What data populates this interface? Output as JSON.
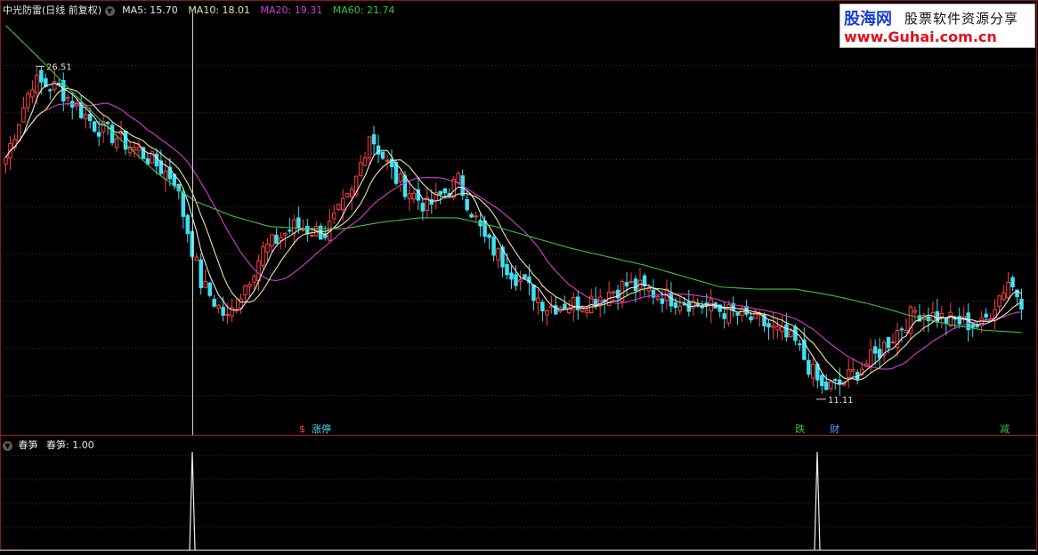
{
  "header": {
    "title": "中光防雷(日线 前复权)",
    "ma": [
      {
        "label": "MA5: 15.70",
        "color": "#e8e8e8"
      },
      {
        "label": "MA10: 18.01",
        "color": "#e8e8a0"
      },
      {
        "label": "MA20: 19.31",
        "color": "#d040d0"
      },
      {
        "label": "MA60: 21.74",
        "color": "#40c040"
      }
    ]
  },
  "indicator": {
    "name": "春笋",
    "value_label": "春笋: 1.00"
  },
  "watermark": {
    "line1_brand": "股海网",
    "line1_text": "股票软件资源分享",
    "line2": "www.Guhai.com.cn"
  },
  "chart_data": [
    {
      "type": "candlestick",
      "title": "中光防雷(日线 前复权)",
      "ylim": [
        9.5,
        29.0
      ],
      "grid": true,
      "colors": {
        "up": "#ff4040",
        "down": "#40e0f0",
        "ma5": "#e8e8e8",
        "ma10": "#e8e8a0",
        "ma20": "#d040d0",
        "ma60": "#40c040"
      },
      "annotations": [
        {
          "text": "26.51",
          "kind": "high",
          "value": 26.51
        },
        {
          "text": "11.11",
          "kind": "low",
          "value": 11.11
        }
      ],
      "signal_markers": [
        {
          "text": "$",
          "color": "#ff4040"
        },
        {
          "text": "涨停",
          "color": "#40e0f0"
        },
        {
          "text": "跌",
          "color": "#40c040"
        },
        {
          "text": "财",
          "color": "#40a0ff"
        },
        {
          "text": "减",
          "color": "#40c040"
        }
      ],
      "ma60_anchor_values": [
        28.4,
        26.7,
        24.9,
        23.2,
        21.6,
        20.3,
        19.6,
        19.1,
        19.0,
        19.0,
        19.3,
        19.5,
        19.5,
        19.1,
        18.6,
        18.1,
        17.7,
        17.3,
        16.8,
        16.3,
        16.2,
        16.2,
        15.9,
        15.5,
        15.0,
        14.6,
        14.3,
        14.2
      ]
    },
    {
      "type": "line",
      "title": "春笋",
      "series": [
        {
          "name": "春笋",
          "spikes": [
            1.0,
            1.0
          ]
        }
      ],
      "ylim": [
        0,
        1.0
      ]
    }
  ]
}
